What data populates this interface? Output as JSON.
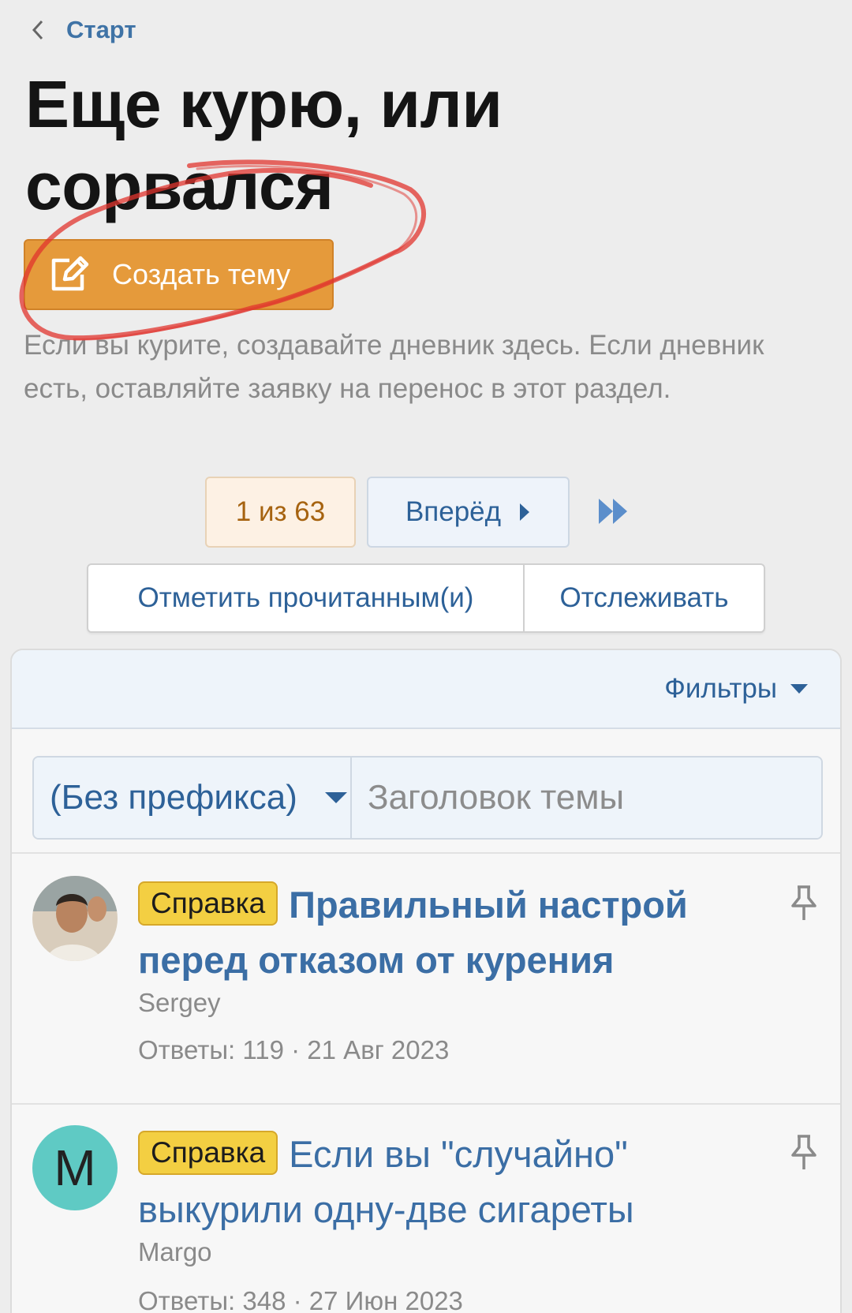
{
  "breadcrumb": {
    "label": "Старт"
  },
  "page_title": "Еще курю, или сорвался",
  "create_button": {
    "label": "Создать тему"
  },
  "description": "Если вы курите, создавайте дневник здесь. Если дневник есть, оставляйте заявку на перенос в этот раздел.",
  "pager": {
    "current": "1 из 63",
    "next_label": "Вперёд"
  },
  "actions": {
    "mark_read": "Отметить прочитанным(и)",
    "watch": "Отслеживать"
  },
  "filters": {
    "label": "Фильтры"
  },
  "quick_thread": {
    "prefix_selected": "(Без префикса)",
    "title_placeholder": "Заголовок темы"
  },
  "threads": [
    {
      "prefix": "Справка",
      "title": "Правильный настрой перед отказом от курения",
      "author": "Sergey",
      "meta": "Ответы: 119 · 21 Авг 2023"
    },
    {
      "prefix": "Справка",
      "title": "Если вы \"случайно\" выкурили одну-две сигареты",
      "author": "Margo",
      "avatar_letter": "M",
      "meta": "Ответы: 348 · 27 Июн 2023"
    }
  ],
  "colors": {
    "accent": "#3b6ea5",
    "create_button": "#e59a3b",
    "prefix_badge": "#f3cf42",
    "avatar_m": "#5fcac4",
    "annotation": "#e0342e"
  }
}
